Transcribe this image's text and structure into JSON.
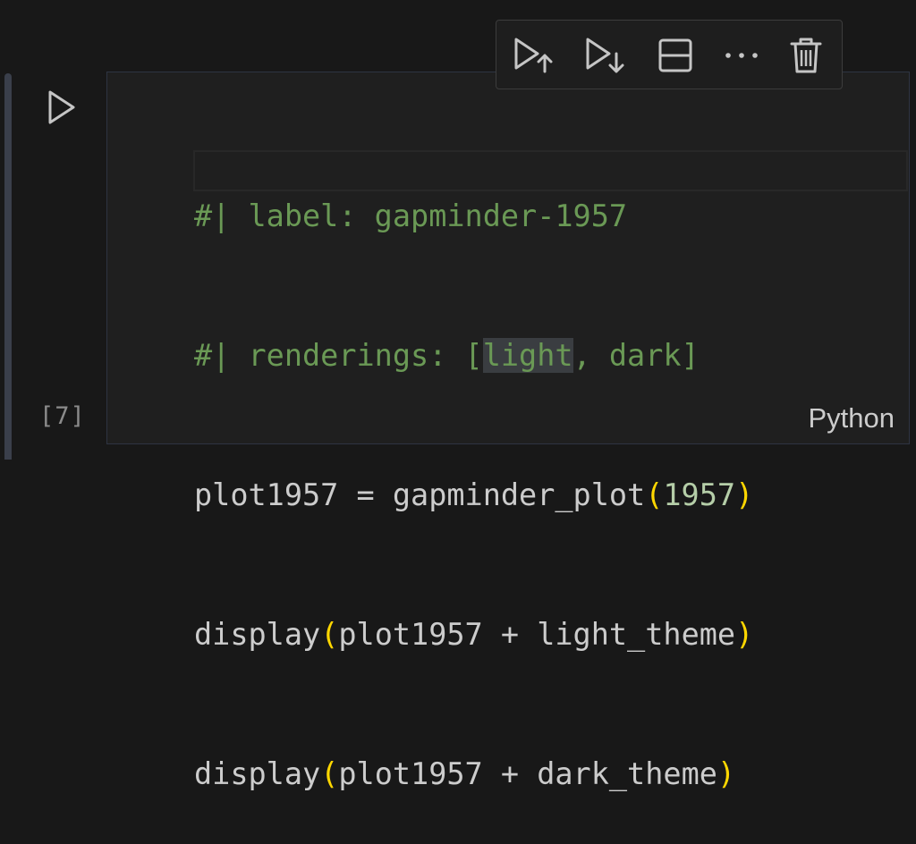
{
  "cell": {
    "execution_count": "[7]",
    "language": "Python",
    "run_icon": "play-icon"
  },
  "toolbar": {
    "buttons": [
      {
        "name": "execute-above-icon"
      },
      {
        "name": "execute-below-icon"
      },
      {
        "name": "split-cell-icon"
      },
      {
        "name": "more-actions-icon"
      },
      {
        "name": "delete-cell-icon"
      }
    ]
  },
  "code": {
    "line1": "#| label: gapminder-1957",
    "line2_pre": "#| renderings: [",
    "line2_word": "light",
    "line2_post": ", dark]",
    "line3_a": "plot1957 = gapminder_plot",
    "line3_open": "(",
    "line3_num": "1957",
    "line3_close": ")",
    "line4_fn": "display",
    "line4_open": "(",
    "line4_body": "plot1957 + light_theme",
    "line4_close": ")",
    "line5_fn": "display",
    "line5_open": "(",
    "line5_body": "plot1957 + dark_theme",
    "line5_close": ")"
  },
  "colors": {
    "background": "#181818",
    "comment": "#6a9955",
    "bracket": "#ffd700",
    "number": "#b5cea8",
    "text": "#cccccc"
  }
}
